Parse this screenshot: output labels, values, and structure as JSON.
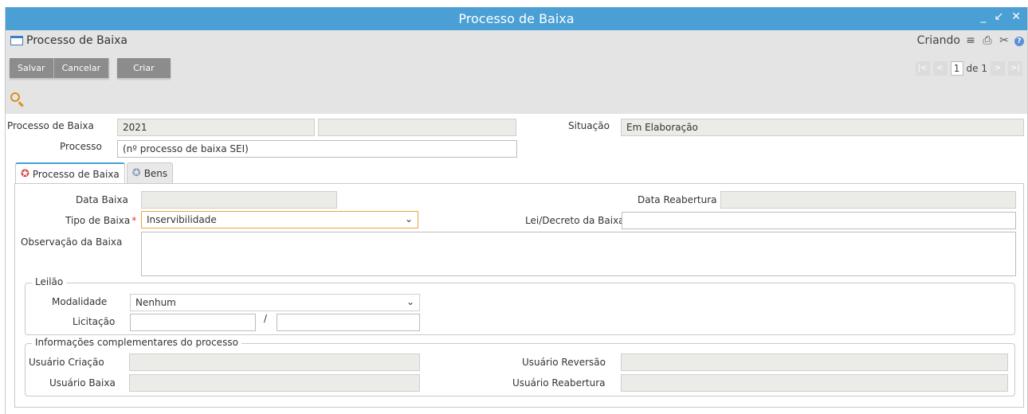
{
  "window": {
    "title": "Processo de Baixa"
  },
  "header": {
    "title": "Processo de Baixa",
    "mode": "Criando"
  },
  "toolbar": {
    "save_label": "Salvar",
    "cancel_label": "Cancelar",
    "create_label": "Criar"
  },
  "pager": {
    "current": "1",
    "total_text": "de 1"
  },
  "top": {
    "processo_baixa_label": "Processo de Baixa",
    "processo_baixa_value": "2021",
    "processo_baixa_value2": "",
    "situacao_label": "Situação",
    "situacao_value": "Em Elaboração",
    "processo_label": "Processo",
    "processo_value": "(nº processo de baixa SEI)"
  },
  "tabs": [
    {
      "label": "Processo de Baixa"
    },
    {
      "label": "Bens"
    }
  ],
  "form": {
    "data_baixa_label": "Data Baixa",
    "data_baixa_value": "",
    "data_reabertura_label": "Data Reabertura",
    "data_reabertura_value": "",
    "tipo_baixa_label": "Tipo de Baixa",
    "tipo_baixa_value": "Inservibilidade",
    "lei_decreto_label": "Lei/Decreto da Baixa",
    "lei_decreto_value": "",
    "observacao_label": "Observação da Baixa",
    "observacao_value": ""
  },
  "leilao": {
    "legend": "Leilão",
    "modalidade_label": "Modalidade",
    "modalidade_value": "Nenhum",
    "licitacao_label": "Licitação",
    "separator": "/",
    "licitacao_value1": "",
    "licitacao_value2": ""
  },
  "info": {
    "legend": "Informações complementares do processo",
    "usuario_criacao_label": "Usuário Criação",
    "usuario_criacao_value": "",
    "usuario_reversao_label": "Usuário Reversão",
    "usuario_reversao_value": "",
    "usuario_baixa_label": "Usuário Baixa",
    "usuario_baixa_value": "",
    "usuario_reabertura_label": "Usuário Reabertura",
    "usuario_reabertura_value": ""
  },
  "icons": {
    "title_icon": "window-icon",
    "menu": "hamburger-menu-icon",
    "print": "printer-icon",
    "tools": "tools-icon",
    "help": "help-icon",
    "search": "search-icon",
    "tab_icon": "star-ribbon-icon"
  },
  "colors": {
    "titlebar": "#4a9fd5",
    "button": "#8c8c8c",
    "required": "#d33333",
    "focus_border": "#e8a43c"
  }
}
